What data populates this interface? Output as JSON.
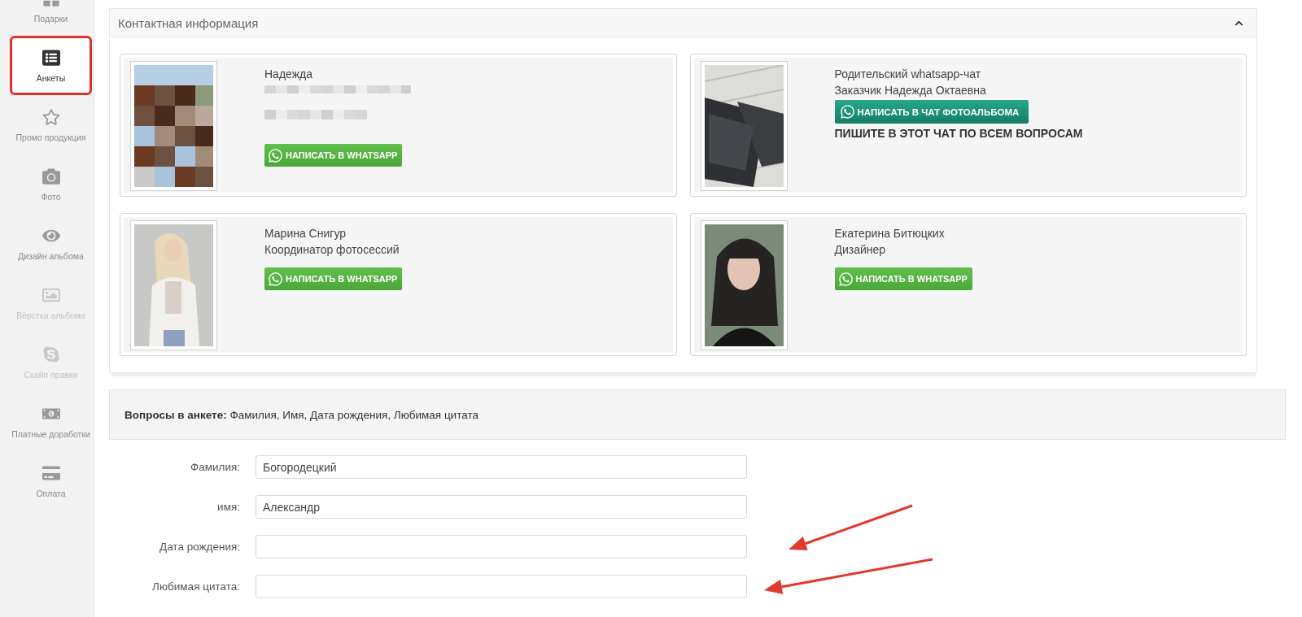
{
  "sidebar": {
    "items": [
      {
        "label": "Подарки",
        "selected": false,
        "disabled": false
      },
      {
        "label": "Анкеты",
        "selected": true,
        "disabled": false
      },
      {
        "label": "Промо продукция",
        "selected": false,
        "disabled": false
      },
      {
        "label": "Фото",
        "selected": false,
        "disabled": false
      },
      {
        "label": "Дизайн альбома",
        "selected": false,
        "disabled": false
      },
      {
        "label": "Вёрстка альбома",
        "selected": false,
        "disabled": true
      },
      {
        "label": "Скайп правки",
        "selected": false,
        "disabled": true
      },
      {
        "label": "Платные доработки",
        "selected": false,
        "disabled": false
      },
      {
        "label": "Оплата",
        "selected": false,
        "disabled": false
      }
    ]
  },
  "contact_panel": {
    "title": "Контактная информация",
    "expanded": true,
    "cards": [
      {
        "lines": [
          "Надежда"
        ],
        "redacted": true,
        "button": {
          "kind": "whatsapp",
          "label": "НАПИСАТЬ В WHATSAPP"
        }
      },
      {
        "lines": [
          "Родительский whatsapp-чат",
          "Заказчик Надежда Октаевна"
        ],
        "redacted": false,
        "button": {
          "kind": "chat",
          "label": "НАПИСАТЬ В ЧАТ ФОТОАЛЬБОМА"
        },
        "note": "ПИШИТЕ В ЭТОТ ЧАТ ПО ВСЕМ ВОПРОСАМ"
      },
      {
        "lines": [
          "Марина Снигур",
          "Координатор фотосессий"
        ],
        "redacted": false,
        "button": {
          "kind": "whatsapp",
          "label": "НАПИСАТЬ В WHATSAPP"
        }
      },
      {
        "lines": [
          "Екатерина Битюцких",
          "Дизайнер"
        ],
        "redacted": false,
        "button": {
          "kind": "whatsapp",
          "label": "НАПИСАТЬ В WHATSAPP"
        }
      }
    ]
  },
  "questions": {
    "text": "**Вопросы в анкете:** Фамилия, Имя, Дата рождения, Любимая цитата"
  },
  "form": {
    "fields": [
      {
        "label": "Фамилия:",
        "value": "Богородецкий"
      },
      {
        "label": "имя:",
        "value": "Александр"
      },
      {
        "label": "Дата рождения:"
      },
      {
        "label": "Любимая цитата:"
      }
    ]
  }
}
